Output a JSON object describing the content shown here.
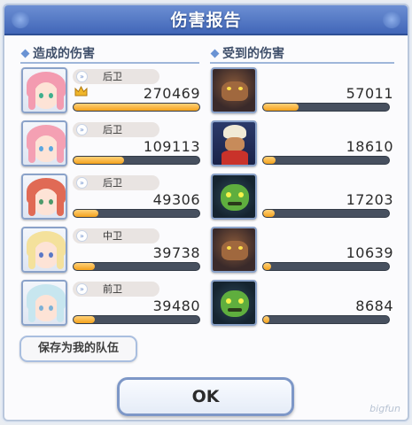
{
  "title": "伤害报告",
  "dealt_header": "造成的伤害",
  "received_header": "受到的伤害",
  "dealt": [
    {
      "role": "后卫",
      "value": "270469",
      "fill": 1.0,
      "top": true,
      "hair": "#f39bb0",
      "eye": "#3fae8d"
    },
    {
      "role": "后卫",
      "value": "109113",
      "fill": 0.4,
      "top": false,
      "hair": "#f4a0b3",
      "eye": "#5aa7e0"
    },
    {
      "role": "后卫",
      "value": "49306",
      "fill": 0.2,
      "top": false,
      "hair": "#e06a55",
      "eye": "#4c9a6a"
    },
    {
      "role": "中卫",
      "value": "39738",
      "fill": 0.17,
      "top": false,
      "hair": "#f4e19c",
      "eye": "#5a77c6"
    },
    {
      "role": "前卫",
      "value": "39480",
      "fill": 0.17,
      "top": false,
      "hair": "#c7e6ef",
      "eye": "#7db1d6"
    }
  ],
  "received": [
    {
      "value": "57011",
      "fill": 0.28,
      "kind": "beast"
    },
    {
      "value": "18610",
      "fill": 0.1,
      "kind": "genie"
    },
    {
      "value": "17203",
      "fill": 0.09,
      "kind": "goblin"
    },
    {
      "value": "10639",
      "fill": 0.06,
      "kind": "beast"
    },
    {
      "value": "8684",
      "fill": 0.05,
      "kind": "goblin"
    }
  ],
  "save_button": "保存为我的队伍",
  "ok_button": "OK",
  "watermark": "bigfun",
  "colors": {
    "bar_fill": "#f4a21c",
    "title_bar": "#4166b8"
  }
}
